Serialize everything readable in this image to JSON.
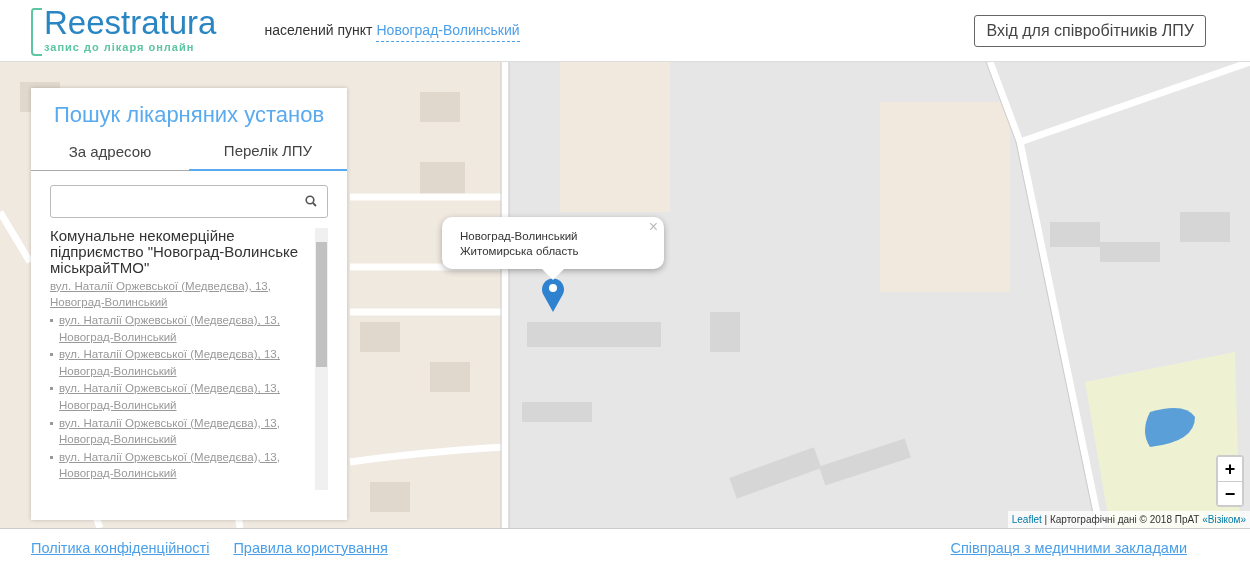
{
  "header": {
    "logo": {
      "name": "Reestratura",
      "tagline": "запис до лікаря онлайн"
    },
    "locality_label": "населений пункт",
    "locality": "Новоград-Волинський",
    "staff_login": "Вхід для співробітників ЛПУ"
  },
  "search_panel": {
    "title": "Пошук лікарняних установ",
    "tabs": [
      {
        "label": "За адресою",
        "selected": false
      },
      {
        "label": "Перелік ЛПУ",
        "selected": true
      }
    ],
    "results": [
      {
        "name": "Комунальне некомерційне підприємство \"Новоград-Волинське міськрайТМО\"",
        "addresses": [
          "вул. Наталії Оржевської (Медведєва), 13, Новоград-Волинський",
          "вул. Наталії Оржевської (Медведєва), 13, Новоград-Волинський",
          "вул. Наталії Оржевської (Медведєва), 13, Новоград-Волинський",
          "вул. Наталії Оржевської (Медведєва), 13, Новоград-Волинський",
          "вул. Наталії Оржевської (Медведєва), 13, Новоград-Волинський",
          "вул. Наталії Оржевської (Медведєва), 13, Новоград-Волинський"
        ]
      }
    ]
  },
  "map": {
    "popup": {
      "lines": [
        "Новоград-Волинський",
        "Житомирська область"
      ],
      "close": "×"
    },
    "zoom_in": "+",
    "zoom_out": "−",
    "attribution": {
      "link": "Leaflet",
      "text": "| Картографічні дані © 2018 ПрАТ",
      "provider": "«Візіком»"
    }
  },
  "footer": {
    "links_left": [
      "Політика конфіденційності",
      "Правила користування"
    ],
    "link_right": "Співпраця з медичними закладами"
  }
}
